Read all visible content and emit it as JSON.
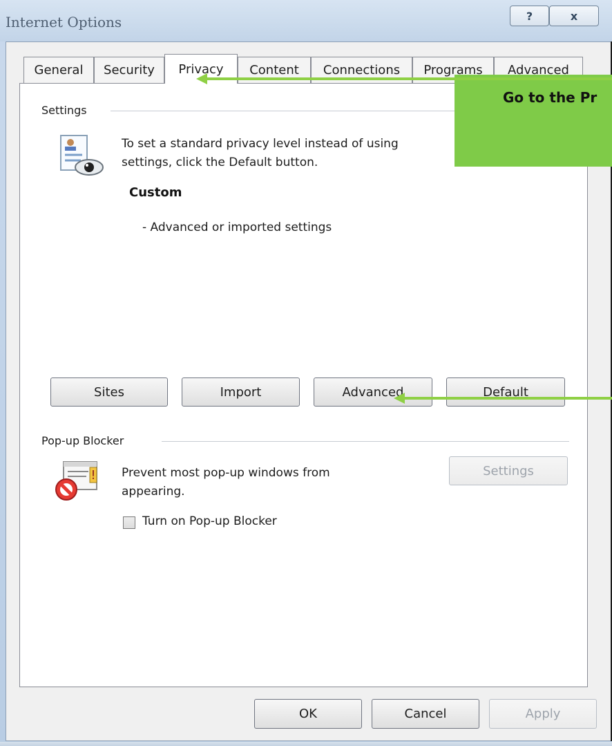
{
  "window": {
    "title": "Internet Options",
    "help": "?",
    "close": "x"
  },
  "tabs": [
    {
      "label": "General",
      "active": false
    },
    {
      "label": "Security",
      "active": false
    },
    {
      "label": "Privacy",
      "active": true
    },
    {
      "label": "Content",
      "active": false
    },
    {
      "label": "Connections",
      "active": false
    },
    {
      "label": "Programs",
      "active": false
    },
    {
      "label": "Advanced",
      "active": false
    }
  ],
  "settings": {
    "label": "Settings",
    "description_line1": "To set a standard privacy level instead of using",
    "description_line2": "settings, click the Default button.",
    "level_title": "Custom",
    "level_desc": "- Advanced or imported settings",
    "buttons": {
      "sites": "Sites",
      "import": "Import",
      "advanced": "Advanced",
      "default": "Default"
    }
  },
  "popup_blocker": {
    "label": "Pop-up Blocker",
    "description_line1": "Prevent most pop-up windows from",
    "description_line2": "appearing.",
    "settings_button": "Settings",
    "checkbox_label": "Turn on Pop-up Blocker",
    "checked": false
  },
  "footer": {
    "ok": "OK",
    "cancel": "Cancel",
    "apply": "Apply"
  },
  "callout": {
    "text": "Go to the Pr"
  },
  "colors": {
    "callout": "#7fcb48",
    "arrow": "#8fd045",
    "panel": "#ffffff",
    "window": "#c9d9ec"
  }
}
